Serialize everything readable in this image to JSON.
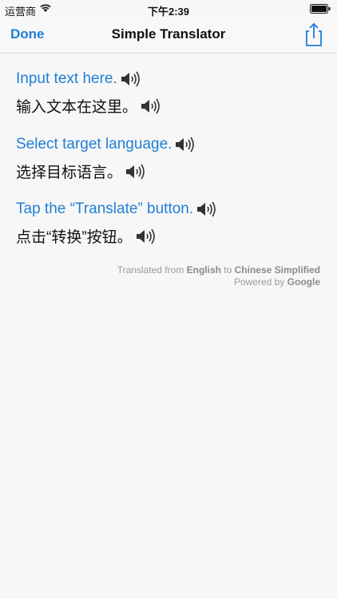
{
  "status_bar": {
    "carrier": "运营商",
    "time": "下午2:39",
    "icons": [
      "wifi-icon",
      "battery-icon"
    ]
  },
  "nav": {
    "done_label": "Done",
    "title": "Simple Translator",
    "share_icon": "share-icon"
  },
  "pairs": [
    {
      "source": "Input text here.",
      "target": "输入文本在这里。"
    },
    {
      "source": "Select target language.",
      "target": "选择目标语言。"
    },
    {
      "source": "Tap the “Translate” button.",
      "target": "点击“转换”按钮。"
    }
  ],
  "footer": {
    "translated_from_prefix": "Translated from ",
    "source_language": "English",
    "to_word": " to ",
    "target_language": "Chinese Simplified",
    "powered_by_prefix": "Powered by ",
    "provider": "Google"
  },
  "colors": {
    "accent": "#1f7fd6",
    "background": "#f7f7f7"
  }
}
